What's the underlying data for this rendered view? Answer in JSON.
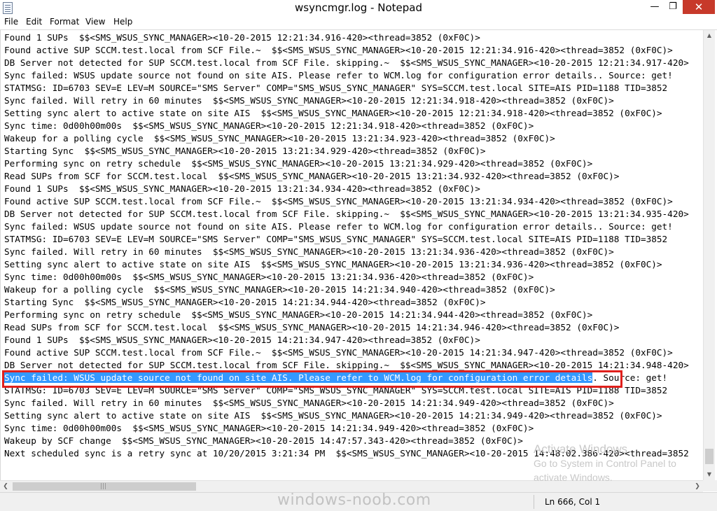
{
  "window": {
    "title": "wsyncmgr.log - Notepad",
    "controls": {
      "minimize": "—",
      "maximize": "❐",
      "close": "✕"
    }
  },
  "menu": [
    "File",
    "Edit",
    "Format",
    "View",
    "Help"
  ],
  "editor": {
    "highlighted_line_index": 27,
    "highlighted_text": "Sync failed: WSUS update source not found on site AIS. Please refer to WCM.log for configuration error details",
    "highlighted_rest": ". Source: get!",
    "lines": [
      "Found 1 SUPs  $$<SMS_WSUS_SYNC_MANAGER><10-20-2015 12:21:34.916-420><thread=3852 (0xF0C)>",
      "Found active SUP SCCM.test.local from SCF File.~  $$<SMS_WSUS_SYNC_MANAGER><10-20-2015 12:21:34.916-420><thread=3852 (0xF0C)>",
      "DB Server not detected for SUP SCCM.test.local from SCF File. skipping.~  $$<SMS_WSUS_SYNC_MANAGER><10-20-2015 12:21:34.917-420>",
      "Sync failed: WSUS update source not found on site AIS. Please refer to WCM.log for configuration error details.. Source: get!",
      "STATMSG: ID=6703 SEV=E LEV=M SOURCE=\"SMS Server\" COMP=\"SMS_WSUS_SYNC_MANAGER\" SYS=SCCM.test.local SITE=AIS PID=1188 TID=3852",
      "Sync failed. Will retry in 60 minutes  $$<SMS_WSUS_SYNC_MANAGER><10-20-2015 12:21:34.918-420><thread=3852 (0xF0C)>",
      "Setting sync alert to active state on site AIS  $$<SMS_WSUS_SYNC_MANAGER><10-20-2015 12:21:34.918-420><thread=3852 (0xF0C)>",
      "Sync time: 0d00h00m00s  $$<SMS_WSUS_SYNC_MANAGER><10-20-2015 12:21:34.918-420><thread=3852 (0xF0C)>",
      "Wakeup for a polling cycle  $$<SMS_WSUS_SYNC_MANAGER><10-20-2015 13:21:34.923-420><thread=3852 (0xF0C)>",
      "Starting Sync  $$<SMS_WSUS_SYNC_MANAGER><10-20-2015 13:21:34.929-420><thread=3852 (0xF0C)>",
      "Performing sync on retry schedule  $$<SMS_WSUS_SYNC_MANAGER><10-20-2015 13:21:34.929-420><thread=3852 (0xF0C)>",
      "Read SUPs from SCF for SCCM.test.local  $$<SMS_WSUS_SYNC_MANAGER><10-20-2015 13:21:34.932-420><thread=3852 (0xF0C)>",
      "Found 1 SUPs  $$<SMS_WSUS_SYNC_MANAGER><10-20-2015 13:21:34.934-420><thread=3852 (0xF0C)>",
      "Found active SUP SCCM.test.local from SCF File.~  $$<SMS_WSUS_SYNC_MANAGER><10-20-2015 13:21:34.934-420><thread=3852 (0xF0C)>",
      "DB Server not detected for SUP SCCM.test.local from SCF File. skipping.~  $$<SMS_WSUS_SYNC_MANAGER><10-20-2015 13:21:34.935-420>",
      "Sync failed: WSUS update source not found on site AIS. Please refer to WCM.log for configuration error details.. Source: get!",
      "STATMSG: ID=6703 SEV=E LEV=M SOURCE=\"SMS Server\" COMP=\"SMS_WSUS_SYNC_MANAGER\" SYS=SCCM.test.local SITE=AIS PID=1188 TID=3852",
      "Sync failed. Will retry in 60 minutes  $$<SMS_WSUS_SYNC_MANAGER><10-20-2015 13:21:34.936-420><thread=3852 (0xF0C)>",
      "Setting sync alert to active state on site AIS  $$<SMS_WSUS_SYNC_MANAGER><10-20-2015 13:21:34.936-420><thread=3852 (0xF0C)>",
      "Sync time: 0d00h00m00s  $$<SMS_WSUS_SYNC_MANAGER><10-20-2015 13:21:34.936-420><thread=3852 (0xF0C)>",
      "Wakeup for a polling cycle  $$<SMS_WSUS_SYNC_MANAGER><10-20-2015 14:21:34.940-420><thread=3852 (0xF0C)>",
      "Starting Sync  $$<SMS_WSUS_SYNC_MANAGER><10-20-2015 14:21:34.944-420><thread=3852 (0xF0C)>",
      "Performing sync on retry schedule  $$<SMS_WSUS_SYNC_MANAGER><10-20-2015 14:21:34.944-420><thread=3852 (0xF0C)>",
      "Read SUPs from SCF for SCCM.test.local  $$<SMS_WSUS_SYNC_MANAGER><10-20-2015 14:21:34.946-420><thread=3852 (0xF0C)>",
      "Found 1 SUPs  $$<SMS_WSUS_SYNC_MANAGER><10-20-2015 14:21:34.947-420><thread=3852 (0xF0C)>",
      "Found active SUP SCCM.test.local from SCF File.~  $$<SMS_WSUS_SYNC_MANAGER><10-20-2015 14:21:34.947-420><thread=3852 (0xF0C)>",
      "DB Server not detected for SUP SCCM.test.local from SCF File. skipping.~  $$<SMS_WSUS_SYNC_MANAGER><10-20-2015 14:21:34.948-420>",
      "",
      "STATMSG: ID=6703 SEV=E LEV=M SOURCE=\"SMS Server\" COMP=\"SMS_WSUS_SYNC_MANAGER\" SYS=SCCM.test.local SITE=AIS PID=1188 TID=3852",
      "Sync failed. Will retry in 60 minutes  $$<SMS_WSUS_SYNC_MANAGER><10-20-2015 14:21:34.949-420><thread=3852 (0xF0C)>",
      "Setting sync alert to active state on site AIS  $$<SMS_WSUS_SYNC_MANAGER><10-20-2015 14:21:34.949-420><thread=3852 (0xF0C)>",
      "Sync time: 0d00h00m00s  $$<SMS_WSUS_SYNC_MANAGER><10-20-2015 14:21:34.949-420><thread=3852 (0xF0C)>",
      "Wakeup by SCF change  $$<SMS_WSUS_SYNC_MANAGER><10-20-2015 14:47:57.343-420><thread=3852 (0xF0C)>",
      "Next scheduled sync is a retry sync at 10/20/2015 3:21:34 PM  $$<SMS_WSUS_SYNC_MANAGER><10-20-2015 14:48:02.386-420><thread=3852"
    ]
  },
  "scrollbars": {
    "up": "▲",
    "down": "▼",
    "left": "❮",
    "right": "❯",
    "grip": "|||"
  },
  "status": {
    "position": "Ln 666, Col 1"
  },
  "overlays": {
    "activate_title": "Activate Windows",
    "activate_line1": "Go to System in Control Panel to",
    "activate_line2": "activate Windows.",
    "site_watermark": "windows-noob.com"
  }
}
